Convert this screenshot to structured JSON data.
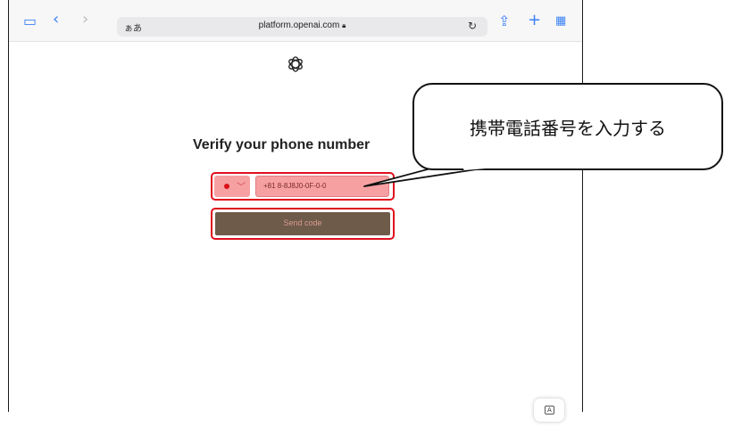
{
  "browser": {
    "aa_label": "ぁあ",
    "url": "platform.openai.com",
    "icons": [
      "sidebar-icon",
      "back-icon",
      "forward-icon",
      "reload-icon",
      "share-icon",
      "new-tab-icon",
      "tabs-grid-icon",
      "lock-icon"
    ]
  },
  "page": {
    "logo_icon": "openai-logo-icon",
    "title": "Verify your phone number",
    "phone_value": "+81 8-8J8J0-0F-0-0",
    "send_button": "Send code",
    "keyboard_icon_label": "A"
  },
  "callout": {
    "text": "携帯電話番号を入力する"
  },
  "colors": {
    "highlight": "#e0101e",
    "input_fill": "#f6a0a2",
    "send_button_fill": "#6e5b4a"
  }
}
